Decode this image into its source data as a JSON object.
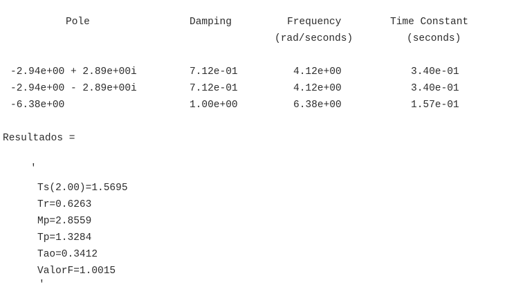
{
  "table": {
    "headers": {
      "pole": "Pole",
      "damping": "Damping",
      "frequency": "Frequency",
      "frequency_unit": "(rad/seconds)",
      "time_constant": "Time Constant",
      "time_constant_unit": "(seconds)"
    },
    "rows": [
      {
        "pole": "-2.94e+00 + 2.89e+00i",
        "damping": "7.12e-01",
        "frequency": "4.12e+00",
        "time_constant": "3.40e-01"
      },
      {
        "pole": "-2.94e+00 - 2.89e+00i",
        "damping": "7.12e-01",
        "frequency": "4.12e+00",
        "time_constant": "3.40e-01"
      },
      {
        "pole": "-6.38e+00",
        "damping": "1.00e+00",
        "frequency": "6.38e+00",
        "time_constant": "1.57e-01"
      }
    ]
  },
  "results": {
    "label": "Resultados =",
    "open_quote": "'",
    "lines": [
      "Ts(2.00)=1.5695",
      "Tr=0.6263",
      "Mp=2.8559",
      "Tp=1.3284",
      "Tao=0.3412",
      "ValorF=1.0015"
    ],
    "close_quote": "'"
  }
}
